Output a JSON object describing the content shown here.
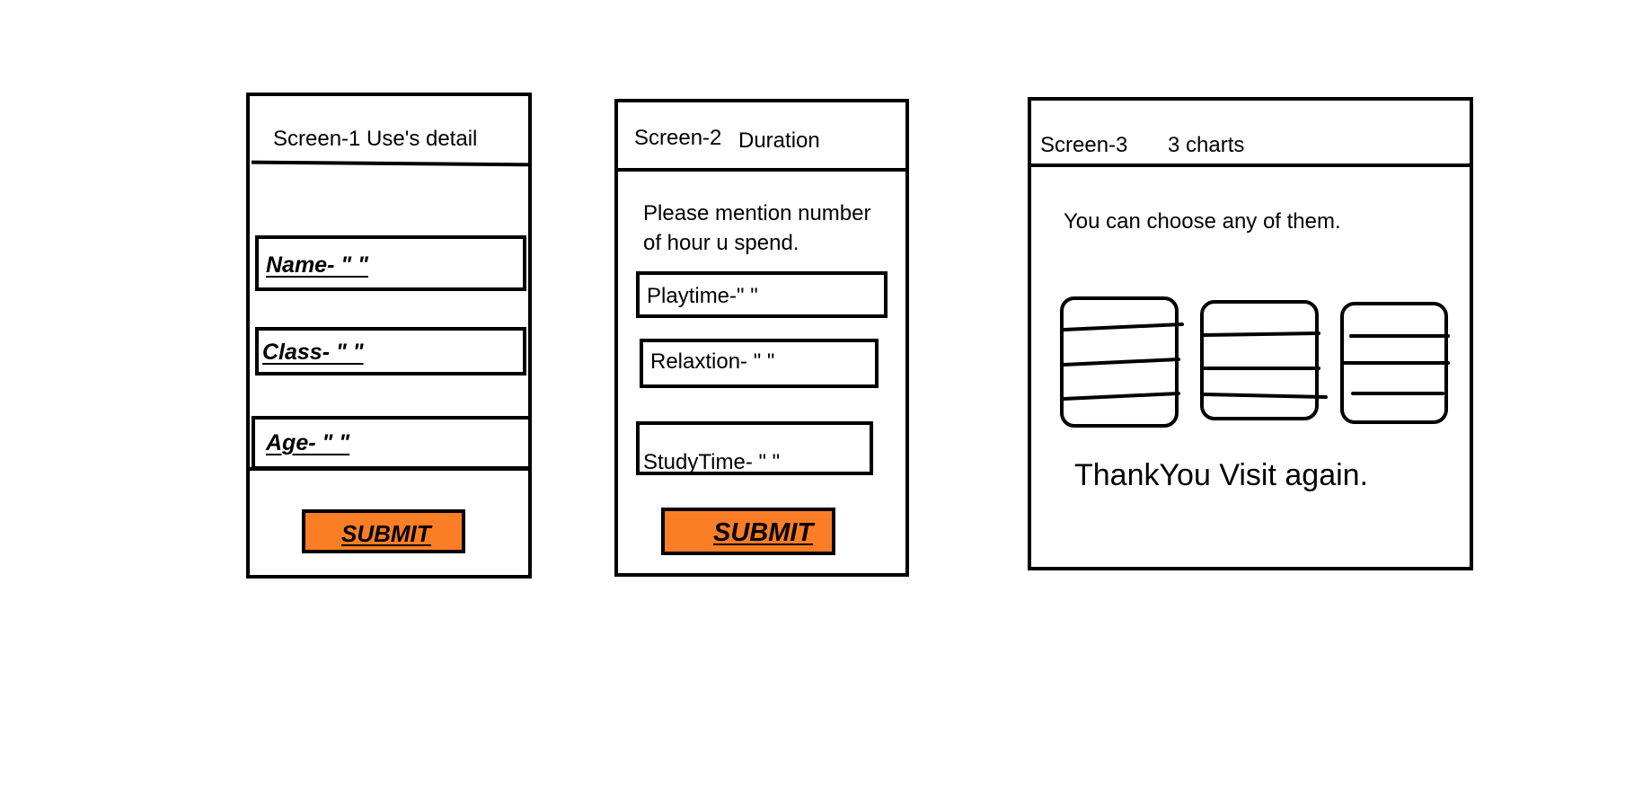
{
  "screen1": {
    "title": "Screen-1   Use's detail",
    "fields": [
      {
        "label": "Name- \"     \""
      },
      {
        "label": "Class- \"         \""
      },
      {
        "label": "Age- \"        \""
      }
    ],
    "submit_label": "SUBMIT"
  },
  "screen2": {
    "title_num": "Screen-2",
    "title_name": "Duration",
    "prompt_line1": "Please mention number",
    "prompt_line2": "of hour u spend.",
    "fields": [
      {
        "label": "Playtime-\"       \""
      },
      {
        "label": "Relaxtion- \"     \""
      },
      {
        "label": "StudyTime- \"        \""
      }
    ],
    "submit_label": "SUBMIT"
  },
  "screen3": {
    "title_num": "Screen-3",
    "title_name": "3 charts",
    "prompt": "You can choose any of them.",
    "thanks": "ThankYou Visit again."
  },
  "colors": {
    "button_fill": "#fb7d26",
    "stroke": "#000000",
    "background": "#ffffff"
  }
}
